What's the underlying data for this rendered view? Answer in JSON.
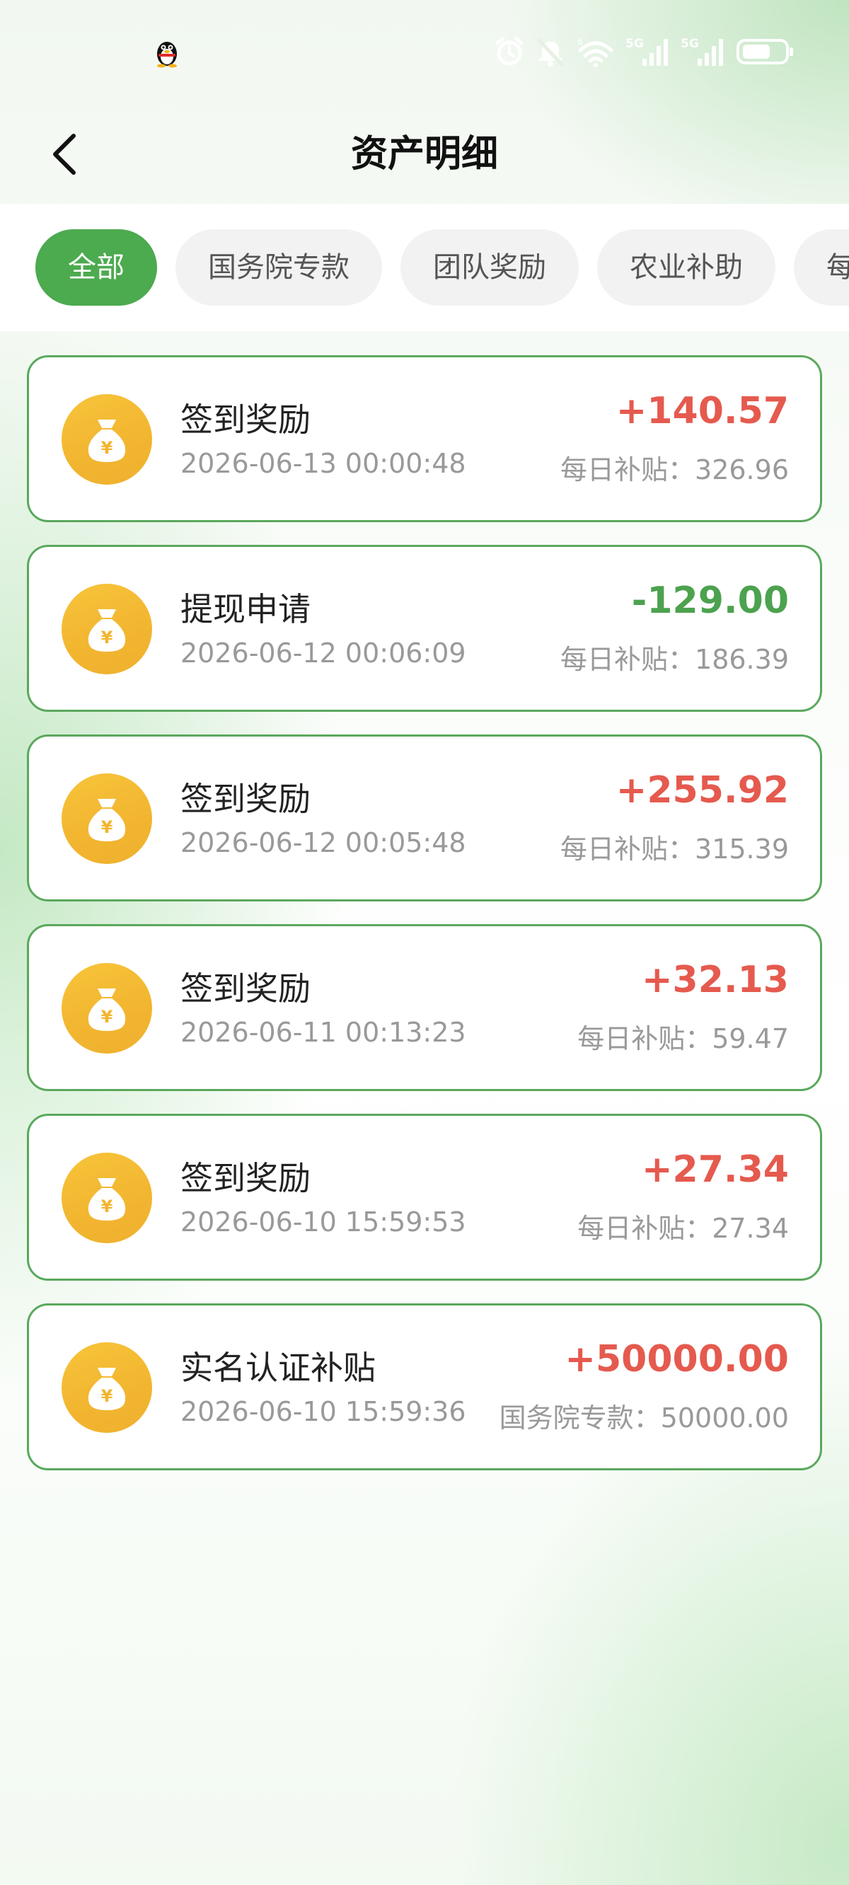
{
  "header": {
    "title": "资产明细"
  },
  "tabs": [
    {
      "label": "全部",
      "active": true
    },
    {
      "label": "国务院专款",
      "active": false
    },
    {
      "label": "团队奖励",
      "active": false
    },
    {
      "label": "农业补助",
      "active": false
    },
    {
      "label": "每",
      "active": false
    }
  ],
  "records": [
    {
      "title": "签到奖励",
      "time": "2026-06-13 00:00:48",
      "amount": "+140.57",
      "type": "positive",
      "note": "每日补贴：326.96"
    },
    {
      "title": "提现申请",
      "time": "2026-06-12 00:06:09",
      "amount": "-129.00",
      "type": "negative",
      "note": "每日补贴：186.39"
    },
    {
      "title": "签到奖励",
      "time": "2026-06-12 00:05:48",
      "amount": "+255.92",
      "type": "positive",
      "note": "每日补贴：315.39"
    },
    {
      "title": "签到奖励",
      "time": "2026-06-11 00:13:23",
      "amount": "+32.13",
      "type": "positive",
      "note": "每日补贴：59.47"
    },
    {
      "title": "签到奖励",
      "time": "2026-06-10 15:59:53",
      "amount": "+27.34",
      "type": "positive",
      "note": "每日补贴：27.34"
    },
    {
      "title": "实名认证补贴",
      "time": "2026-06-10 15:59:36",
      "amount": "+50000.00",
      "type": "positive",
      "note": "国务院专款：50000.00"
    }
  ],
  "colors": {
    "accent": "#4caa4f",
    "positive_amount": "#e55a4e",
    "negative_amount": "#4ca24e",
    "card_border": "#5aa85c",
    "icon_gold": "#f2b530"
  },
  "icons": {
    "back": "chevron-left-icon",
    "record": "money-bag-icon",
    "status": [
      "qq-penguin-icon",
      "alarm-icon",
      "bell-off-icon",
      "wifi-icon",
      "signal-5g-icon",
      "signal-5g-icon",
      "battery-icon"
    ]
  }
}
